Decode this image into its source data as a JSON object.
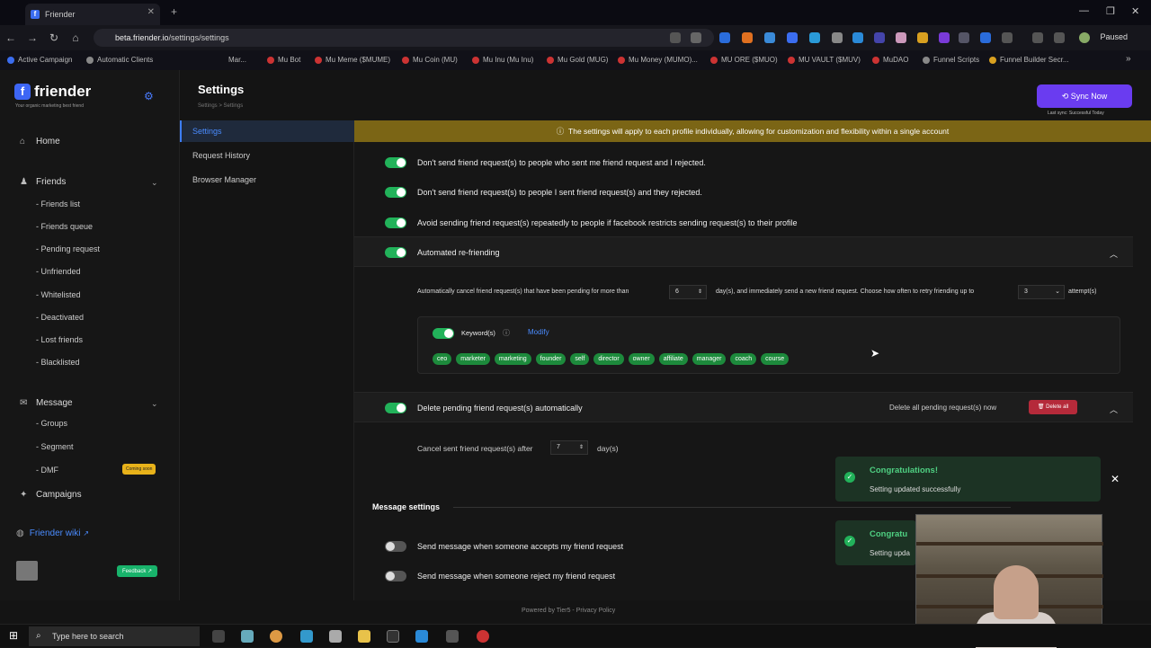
{
  "browser": {
    "tab_title": "Friender",
    "url_host": "beta.friender.io",
    "url_path": "/settings/settings",
    "profile_status": "Paused",
    "bookmarks": [
      "Active Campaign",
      "Automatic Clients",
      "Mar...",
      "Mu Bot",
      "Mu Meme ($MUME)",
      "Mu Coin (MU)",
      "Mu Inu (Mu Inu)",
      "Mu Gold (MUG)",
      "Mu Money (MUMO)...",
      "MU ORE ($MUO)",
      "MU VAULT ($MUV)",
      "MuDAO",
      "Funnel Scripts",
      "Funnel Builder Secr..."
    ]
  },
  "sidebar": {
    "brand": "friender",
    "tagline": "Your organic marketing best friend",
    "home": "Home",
    "friends": "Friends",
    "friends_items": [
      "- Friends list",
      "- Friends queue",
      "- Pending request",
      "- Unfriended",
      "- Whitelisted",
      "- Deactivated",
      "- Lost friends",
      "- Blacklisted"
    ],
    "message": "Message",
    "message_items": [
      "- Groups",
      "- Segment",
      "- DMF"
    ],
    "coming_soon": "Coming soon",
    "campaigns": "Campaigns",
    "wiki": "Friender wiki",
    "feedback": "Feedback"
  },
  "header": {
    "title": "Settings",
    "breadcrumb": "Settings  >  Settings",
    "sync_button": "Sync Now",
    "last_sync": "Last sync: Successful Today"
  },
  "subnav": {
    "items": [
      "Settings",
      "Request History",
      "Browser Manager"
    ]
  },
  "content": {
    "banner": "The settings will apply to each profile individually, allowing for customization and flexibility within a single account",
    "opt1": "Don't send friend request(s) to people who sent me friend request and I rejected.",
    "opt2": "Don't send friend request(s) to people I sent friend request(s) and they rejected.",
    "opt3": "Avoid sending friend request(s) repeatedly to people if facebook restricts sending request(s) to their profile",
    "refriending": "Automated re-friending",
    "auto_pre": "Automatically cancel friend request(s) that have been pending for more than",
    "auto_days": "6",
    "auto_mid": "day(s), and immediately send a new friend request. Choose how often to retry friending up to",
    "auto_attempts": "3",
    "auto_post": "attempt(s)",
    "keywords_label": "Keyword(s)",
    "modify": "Modify",
    "keywords": [
      "ceo",
      "marketer",
      "marketing",
      "founder",
      "self",
      "director",
      "owner",
      "affiliate",
      "manager",
      "coach",
      "course"
    ],
    "delete_pending": "Delete pending friend request(s) automatically",
    "delete_all_text": "Delete all pending request(s) now",
    "delete_all_btn": "Delete all",
    "cancel_pre": "Cancel sent friend request(s) after",
    "cancel_days": "7",
    "cancel_post": "day(s)",
    "message_settings": "Message settings",
    "msg1": "Send message when someone accepts my friend request",
    "msg2": "Send message when someone reject my friend request"
  },
  "toasts": [
    {
      "title": "Congratulations!",
      "message": "Setting updated successfully"
    },
    {
      "title": "Congratu",
      "message": "Setting upda"
    }
  ],
  "footer": {
    "powered": "Powered by Tier5 - Privacy Policy"
  },
  "taskbar": {
    "search": "Type here to search"
  }
}
